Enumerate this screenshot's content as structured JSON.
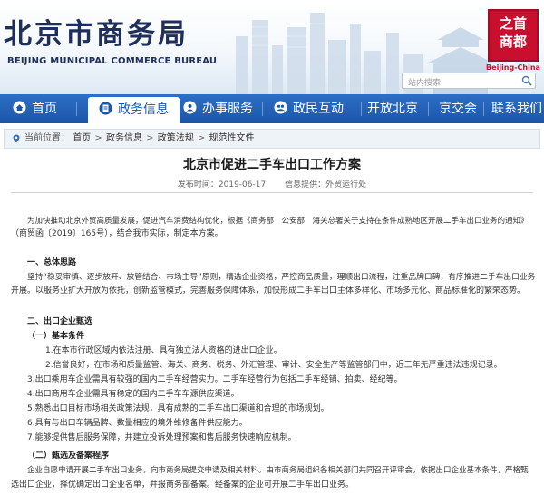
{
  "header": {
    "logo_cn": "北京市商务局",
    "logo_en": "BEIJING MUNICIPAL COMMERCE BUREAU",
    "seal_top": "之首",
    "seal_bottom": "商都",
    "seal_caption": "Beijing-China",
    "search_placeholder": "站内搜索"
  },
  "nav": {
    "items": [
      {
        "label": "首页",
        "icon": "home-icon"
      },
      {
        "label": "政务信息",
        "icon": "document-icon"
      },
      {
        "label": "办事服务",
        "icon": "service-icon"
      },
      {
        "label": "政民互动",
        "icon": "interaction-icon"
      },
      {
        "label": "开放北京"
      },
      {
        "label": "京交会"
      },
      {
        "label": "联系我们"
      }
    ]
  },
  "breadcrumb": {
    "prefix": "当前位置：",
    "items": [
      "首页",
      "政务信息",
      "政策法规",
      "规范性文件"
    ],
    "sep": ">"
  },
  "article": {
    "title": "北京市促进二手车出口工作方案",
    "publish_date": "发布时间：2019-06-17",
    "source": "信息提供：外贸运行处",
    "lines": [
      "为加快推动北京外贸高质量发展，促进汽车消费结构优化，根据《商务部　公安部　海关总署关于支持在条件成熟地区开展二手车出口业务的通知》",
      "（商贸函〔2019〕165号），结合我市实际，制定本方案。",
      "一、总体思路",
      "坚持“稳妥审慎、逐步放开、放管结合、市场主导”原则，精选企业资格，严控商品质量，理顺出口流程，注重品牌口碑，有序推进二手车出口业务",
      "开展。以服务业扩大开放为依托，创新监管模式，完善服务保障体系，加快形成二手车出口主体多样化、市场多元化、商品标准化的繁荣态势。",
      "二、出口企业甄选",
      "（一）基本条件",
      "1.在本市行政区域内依法注册、具有独立法人资格的进出口企业。",
      "2.信誉良好，在市场和质量监管、海关、商务、税务、外汇管理、审计、安全生产等监管部门中，近三年无严重违法违规记录。",
      "3.出口乘用车企业需具有较强的国内二手车经营实力。二手车经营行为包括二手车经销、拍卖、经纪等。",
      "4.出口商用车企业需具有稳定的国内二手车车源供应渠道。",
      "5.熟悉出口目标市场相关政策法规，具有成熟的二手车出口渠道和合理的市场规划。",
      "6.具有与出口车辆品牌、数量相应的境外维修备件供应能力。",
      "7.能够提供售后服务保障，并建立投诉处理预案和售后服务快速响应机制。",
      "（二）甄选及备案程序",
      "企业自愿申请开展二手车出口业务，向市商务局提交申请及相关材料。由市商务局组织各相关部门共同召开评审会，依据出口企业基本条件，严格甄",
      "选出口企业，择优确定出口企业名单，并报商务部备案。经备案的企业可开展二手车出口业务。"
    ]
  },
  "colors": {
    "nav_bg": "#1c55a8",
    "logo_text": "#1f2f5c",
    "seal_red": "#c8102e"
  }
}
